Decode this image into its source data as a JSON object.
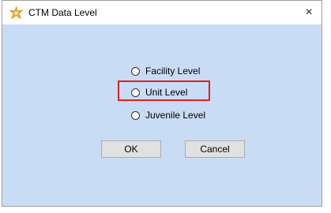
{
  "window": {
    "title": "CTM Data Level",
    "close_symbol": "×",
    "title_icon": "gear-star-icon"
  },
  "options": [
    {
      "label": "Facility Level",
      "selected": false
    },
    {
      "label": "Unit Level",
      "selected": false,
      "highlighted": true
    },
    {
      "label": "Juvenile Level",
      "selected": false
    }
  ],
  "buttons": {
    "ok_label": "OK",
    "cancel_label": "Cancel"
  },
  "colors": {
    "client_background": "#c9dcf5",
    "highlight": "#e02020"
  }
}
